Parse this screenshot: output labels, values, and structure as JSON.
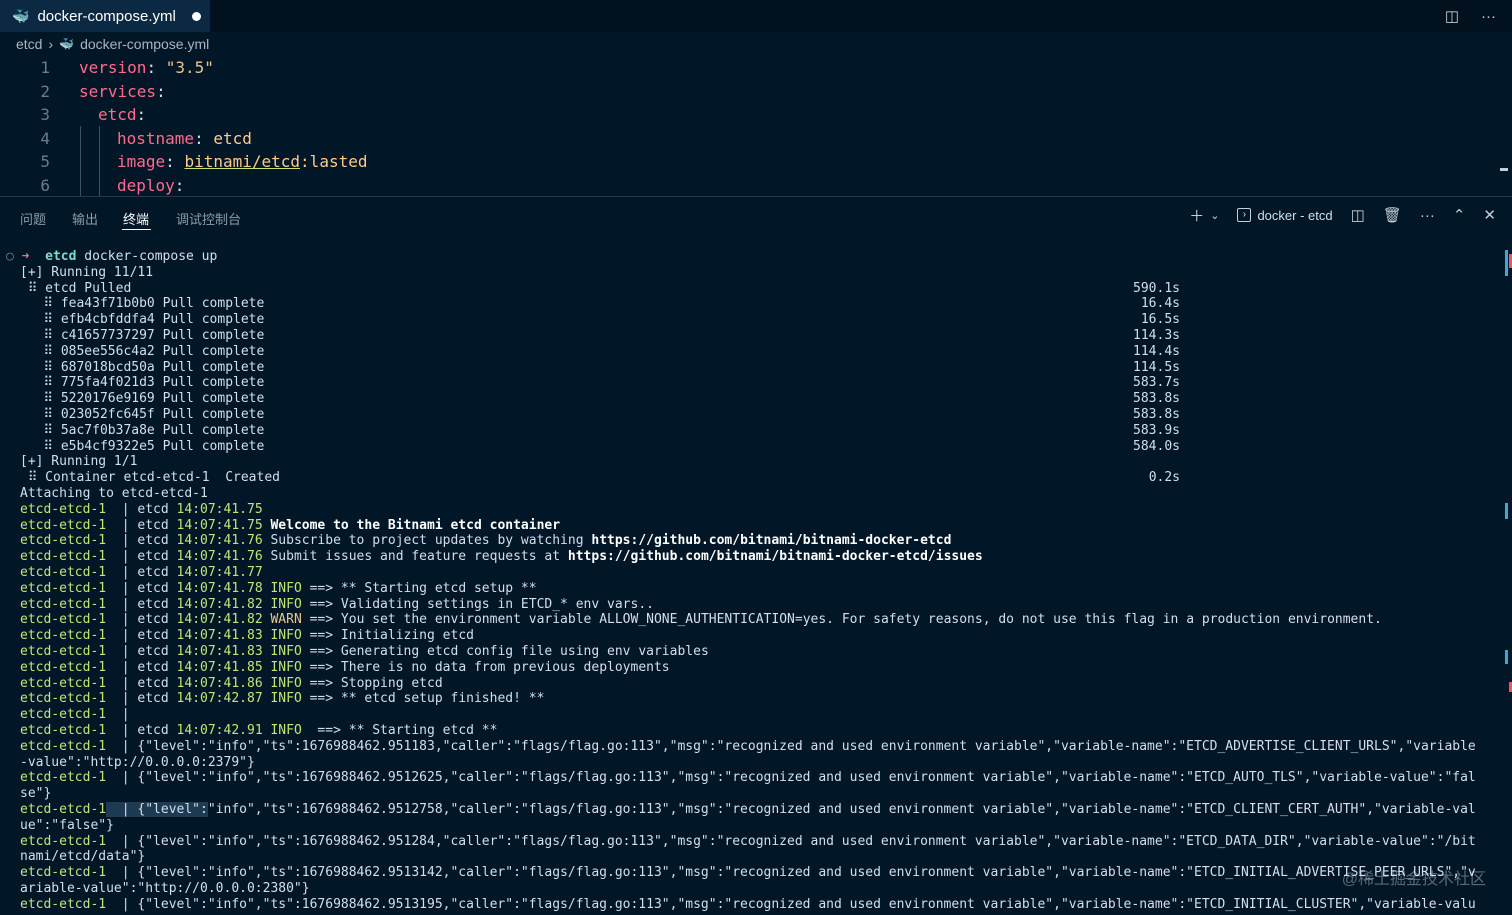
{
  "tab": {
    "title": "docker-compose.yml",
    "icon": "docker-whale-icon"
  },
  "breadcrumb": {
    "folder": "etcd",
    "file": "docker-compose.yml"
  },
  "editor": {
    "line_numbers": [
      "1",
      "2",
      "3",
      "4",
      "5",
      "6"
    ],
    "l1": {
      "key": "version",
      "colon": ":",
      "value": "\"3.5\""
    },
    "l2": {
      "key": "services",
      "colon": ":"
    },
    "l3": {
      "key": "etcd",
      "colon": ":"
    },
    "l4": {
      "key": "hostname",
      "colon": ":",
      "value": "etcd"
    },
    "l5": {
      "key": "image",
      "colon": ":",
      "value_a": "bitnami/etcd",
      "value_b": ":lasted"
    },
    "l6": {
      "key": "deploy",
      "colon": ":"
    }
  },
  "panel": {
    "tabs": [
      "问题",
      "输出",
      "终端",
      "调试控制台"
    ],
    "active_tab": "终端",
    "terminal_name": "docker - etcd"
  },
  "terminal": {
    "prompt_dir": "etcd",
    "prompt_cmd": "docker-compose up",
    "running1": "[+] Running 11/11",
    "pulled": " ⠿ etcd Pulled",
    "pulled_time": "590.1s",
    "layers": [
      {
        "id": "fea43f71b0b0",
        "status": "Pull complete",
        "time": "16.4s"
      },
      {
        "id": "efb4cbfddfa4",
        "status": "Pull complete",
        "time": "16.5s"
      },
      {
        "id": "c41657737297",
        "status": "Pull complete",
        "time": "114.3s"
      },
      {
        "id": "085ee556c4a2",
        "status": "Pull complete",
        "time": "114.4s"
      },
      {
        "id": "687018bcd50a",
        "status": "Pull complete",
        "time": "114.5s"
      },
      {
        "id": "775fa4f021d3",
        "status": "Pull complete",
        "time": "583.7s"
      },
      {
        "id": "5220176e9169",
        "status": "Pull complete",
        "time": "583.8s"
      },
      {
        "id": "023052fc645f",
        "status": "Pull complete",
        "time": "583.8s"
      },
      {
        "id": "5ac7f0b37a8e",
        "status": "Pull complete",
        "time": "583.9s"
      },
      {
        "id": "e5b4cf9322e5",
        "status": "Pull complete",
        "time": "584.0s"
      }
    ],
    "running2": "[+] Running 1/1",
    "created": " ⠿ Container etcd-etcd-1  Created",
    "created_time": "0.2s",
    "attaching": "Attaching to etcd-etcd-1",
    "container": "etcd-etcd-1",
    "logs": [
      {
        "ts": "14:07:41.75",
        "level": "",
        "msg": "",
        "bold": false
      },
      {
        "ts": "14:07:41.75",
        "level": "",
        "msg": "Welcome to the Bitnami etcd container",
        "bold": true
      },
      {
        "ts": "14:07:41.76",
        "level": "",
        "msg": "Subscribe to project updates by watching ",
        "link": "https://github.com/bitnami/bitnami-docker-etcd"
      },
      {
        "ts": "14:07:41.76",
        "level": "",
        "msg": "Submit issues and feature requests at ",
        "link": "https://github.com/bitnami/bitnami-docker-etcd/issues"
      },
      {
        "ts": "14:07:41.77",
        "level": "",
        "msg": "",
        "bold": false
      },
      {
        "ts": "14:07:41.78",
        "level": "INFO",
        "msg": "==> ** Starting etcd setup **"
      },
      {
        "ts": "14:07:41.82",
        "level": "INFO",
        "msg": "==> Validating settings in ETCD_* env vars.."
      },
      {
        "ts": "14:07:41.82",
        "level": "WARN",
        "msg": "==> You set the environment variable ALLOW_NONE_AUTHENTICATION=yes. For safety reasons, do not use this flag in a production environment."
      },
      {
        "ts": "14:07:41.83",
        "level": "INFO",
        "msg": "==> Initializing etcd"
      },
      {
        "ts": "14:07:41.83",
        "level": "INFO",
        "msg": "==> Generating etcd config file using env variables"
      },
      {
        "ts": "14:07:41.85",
        "level": "INFO",
        "msg": "==> There is no data from previous deployments"
      },
      {
        "ts": "14:07:41.86",
        "level": "INFO",
        "msg": "==> Stopping etcd"
      },
      {
        "ts": "14:07:42.87",
        "level": "INFO",
        "msg": "==> ** etcd setup finished! **"
      }
    ],
    "empty_line": "etcd-etcd-1  |",
    "start_log": {
      "ts": "14:07:42.91",
      "level": "INFO",
      "msg": "==> ** Starting etcd **"
    },
    "json_lines": [
      {
        "a": "{\"level\":\"info\",\"ts\":1676988462.951183,\"caller\":\"flags/flag.go:113\",\"msg\":\"recognized and used environment variable\",\"variable-name\":\"ETCD_ADVERTISE_CLIENT_URLS\",\"variable",
        "b": "-value\":\"http://0.0.0.0:2379\"}"
      },
      {
        "a": "{\"level\":\"info\",\"ts\":1676988462.9512625,\"caller\":\"flags/flag.go:113\",\"msg\":\"recognized and used environment variable\",\"variable-name\":\"ETCD_AUTO_TLS\",\"variable-value\":\"fal",
        "b": "se\"}"
      },
      {
        "a": "{\"level\":\"info\",\"ts\":1676988462.9512758,\"caller\":\"flags/flag.go:113\",\"msg\":\"recognized and used environment variable\",\"variable-name\":\"ETCD_CLIENT_CERT_AUTH\",\"variable-val",
        "b": "ue\":\"false\"}"
      },
      {
        "a": "{\"level\":\"info\",\"ts\":1676988462.951284,\"caller\":\"flags/flag.go:113\",\"msg\":\"recognized and used environment variable\",\"variable-name\":\"ETCD_DATA_DIR\",\"variable-value\":\"/bit",
        "b": "nami/etcd/data\"}"
      },
      {
        "a": "{\"level\":\"info\",\"ts\":1676988462.9513142,\"caller\":\"flags/flag.go:113\",\"msg\":\"recognized and used environment variable\",\"variable-name\":\"ETCD_INITIAL_ADVERTISE_PEER_URLS\",\"v",
        "b": "ariable-value\":\"http://0.0.0.0:2380\"}"
      },
      {
        "a": "{\"level\":\"info\",\"ts\":1676988462.9513195,\"caller\":\"flags/flag.go:113\",\"msg\":\"recognized and used environment variable\",\"variable-name\":\"ETCD_INITIAL_CLUSTER\",\"variable-valu",
        "b": ""
      }
    ]
  },
  "watermark": "@稀土掘金技术社区"
}
